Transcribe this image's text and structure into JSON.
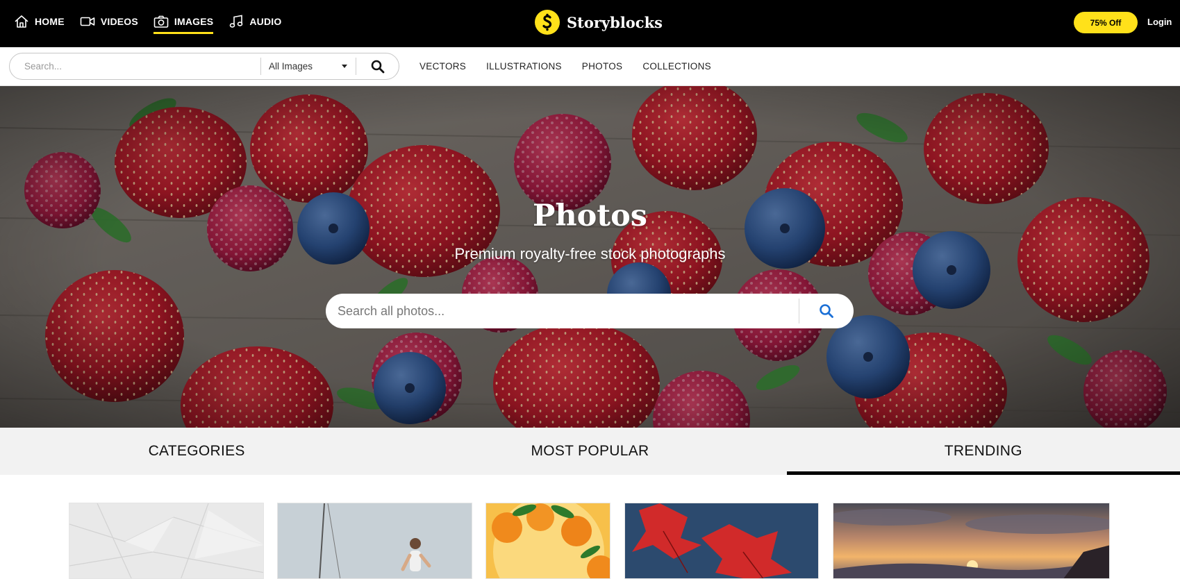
{
  "topnav": {
    "items": [
      {
        "label": "HOME",
        "icon": "home-icon"
      },
      {
        "label": "VIDEOS",
        "icon": "video-camera-icon"
      },
      {
        "label": "IMAGES",
        "icon": "camera-icon",
        "active": true
      },
      {
        "label": "AUDIO",
        "icon": "music-note-icon"
      }
    ],
    "brand": {
      "name": "Storyblocks",
      "logo_icon": "storyblocks-logo-icon"
    },
    "promo_label": "75% Off",
    "login_label": "Login"
  },
  "subbar": {
    "search_placeholder": "Search...",
    "filter_selected": "All Images",
    "links": [
      "VECTORS",
      "ILLUSTRATIONS",
      "PHOTOS",
      "COLLECTIONS"
    ]
  },
  "hero": {
    "title": "Photos",
    "subtitle": "Premium royalty-free stock photographs",
    "search_placeholder": "Search all photos...",
    "background": "strawberries-blueberries-raspberries-on-wood"
  },
  "tabs": {
    "items": [
      {
        "label": "CATEGORIES"
      },
      {
        "label": "MOST POPULAR"
      },
      {
        "label": "TRENDING",
        "active": true
      }
    ]
  },
  "thumbnails": [
    {
      "subject": "crumpled-white-paper"
    },
    {
      "subject": "woman-running-near-sailboat"
    },
    {
      "subject": "oranges-on-branch"
    },
    {
      "subject": "red-maple-leaves"
    },
    {
      "subject": "sunset-over-hills"
    }
  ],
  "colors": {
    "accent_yellow": "#ffe11a",
    "nav_background": "#000000",
    "search_icon_blue": "#1a6fd6",
    "tabs_background": "#f2f2f2"
  }
}
